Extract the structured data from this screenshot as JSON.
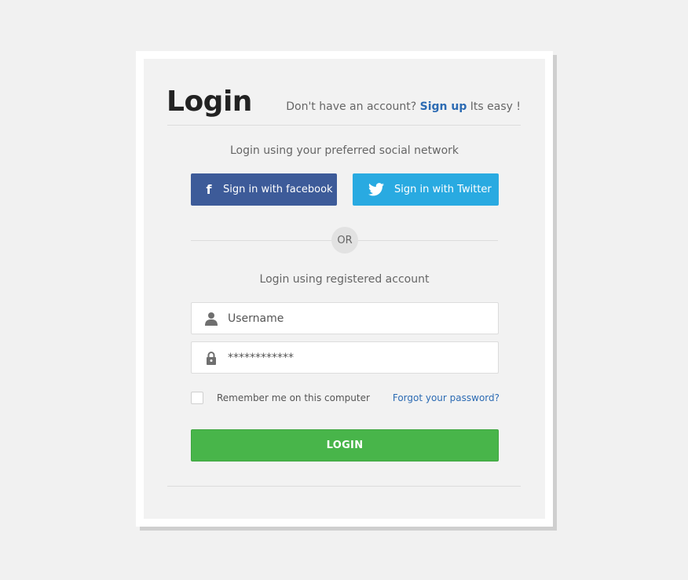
{
  "login": {
    "title": "Login",
    "signup_prompt": "Don't have an account?",
    "signup_link": "Sign up",
    "signup_suffix": "Its easy !",
    "social_subtitle": "Login using your preferred social network",
    "facebook_label": "Sign in with facebook",
    "twitter_label": "Sign in with Twitter",
    "or_label": "OR",
    "account_subtitle": "Login using registered account",
    "username_placeholder": "Username",
    "password_placeholder": "************",
    "remember_label": "Remember me on this computer",
    "forgot_label": "Forgot your password?",
    "submit_label": "LOGIN"
  },
  "icons": {
    "facebook": "facebook-icon",
    "twitter": "twitter-icon",
    "username": "user-icon",
    "password": "lock-icon"
  },
  "colors": {
    "facebook": "#3d5b99",
    "twitter": "#29aae1",
    "submit": "#48b54a",
    "link": "#2c6bb3",
    "page_background": "#f1f1f1",
    "card_background": "#f2f2f2"
  },
  "state": {
    "remember_checked": false
  }
}
